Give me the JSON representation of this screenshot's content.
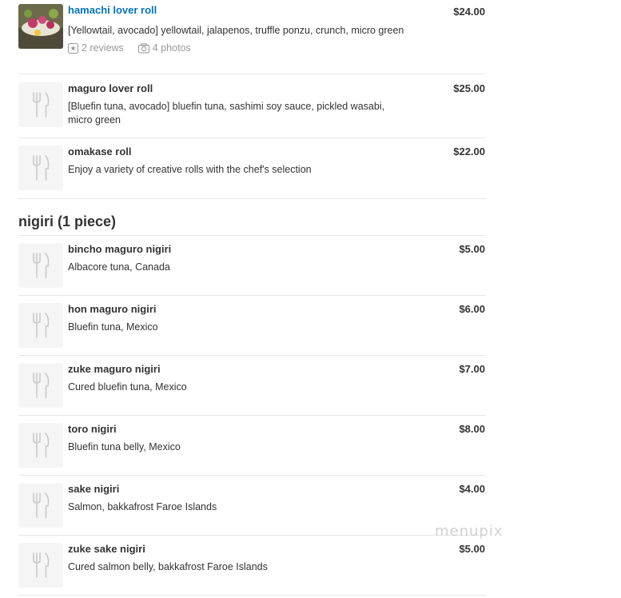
{
  "rolls": [
    {
      "name": "hamachi lover roll",
      "desc": "[Yellowtail, avocado] yellowtail, jalapenos, truffle ponzu, crunch, micro green",
      "price": "$24.00",
      "reviews": "2 reviews",
      "photos": "4 photos"
    },
    {
      "name": "maguro lover roll",
      "desc": "[Bluefin tuna, avocado] bluefin tuna, sashimi soy sauce, pickled wasabi, micro green",
      "price": "$25.00"
    },
    {
      "name": "omakase roll",
      "desc": "Enjoy a variety of creative rolls with the chef's selection",
      "price": "$22.00"
    }
  ],
  "nigiri_section": {
    "title": "nigiri (1 piece)",
    "items": [
      {
        "name": "bincho maguro nigiri",
        "desc": "Albacore tuna, Canada",
        "price": "$5.00"
      },
      {
        "name": "hon maguro nigiri",
        "desc": "Bluefin tuna, Mexico",
        "price": "$6.00"
      },
      {
        "name": "zuke maguro nigiri",
        "desc": "Cured bluefin tuna, Mexico",
        "price": "$7.00"
      },
      {
        "name": "toro nigiri",
        "desc": "Bluefin tuna belly, Mexico",
        "price": "$8.00"
      },
      {
        "name": "sake nigiri",
        "desc": "Salmon, bakkafrost Faroe Islands",
        "price": "$4.00"
      },
      {
        "name": "zuke sake nigiri",
        "desc": "Cured salmon belly, bakkafrost Faroe Islands",
        "price": "$5.00"
      }
    ]
  },
  "watermark": "menupix",
  "icons": {
    "placeholder": "fork-knife-icon",
    "reviews": "review-star-icon",
    "photos": "camera-icon"
  },
  "colors": {
    "link": "#0073bb",
    "text": "#333333",
    "muted": "#999999",
    "divider": "#e6e6e6",
    "placeholder_bg": "#f5f5f5"
  }
}
